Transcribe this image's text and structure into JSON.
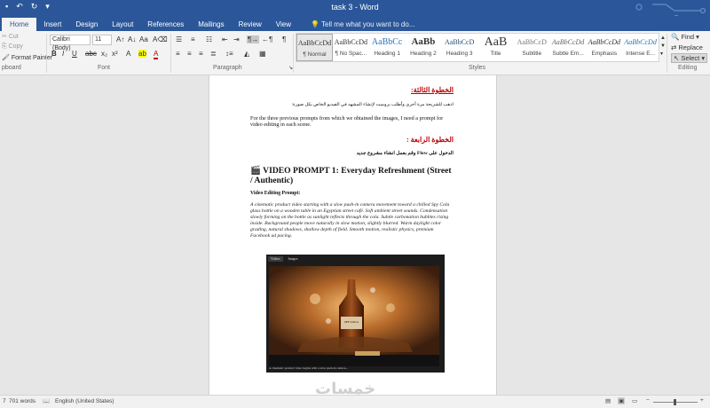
{
  "window": {
    "title": "task 3 - Word"
  },
  "tabs": [
    "Home",
    "Insert",
    "Design",
    "Layout",
    "References",
    "Mailings",
    "Review",
    "View"
  ],
  "tellme": "Tell me what you want to do...",
  "clipboard": {
    "cut": "Cut",
    "copy": "Copy",
    "painter": "Format Painter",
    "label": "pboard"
  },
  "font": {
    "name": "Calibri (Body)",
    "size": "11",
    "label": "Font"
  },
  "paragraph": {
    "label": "Paragraph"
  },
  "styles": {
    "label": "Styles",
    "items": [
      {
        "preview": "AaBbCcDd",
        "name": "¶ Normal"
      },
      {
        "preview": "AaBbCcDd",
        "name": "¶ No Spac..."
      },
      {
        "preview": "AaBbCc",
        "name": "Heading 1"
      },
      {
        "preview": "AaBb",
        "name": "Heading 2"
      },
      {
        "preview": "AaBbCcD",
        "name": "Heading 3"
      },
      {
        "preview": "AaB",
        "name": "Title"
      },
      {
        "preview": "AaBbCcD",
        "name": "Subtitle"
      },
      {
        "preview": "AaBbCcDd",
        "name": "Subtle Em..."
      },
      {
        "preview": "AaBbCcDd",
        "name": "Emphasis"
      },
      {
        "preview": "AaBbCcDd",
        "name": "Intense E..."
      }
    ]
  },
  "editing": {
    "find": "Find",
    "replace": "Replace",
    "select": "Select",
    "label": "Editing"
  },
  "document": {
    "step3_title": "الخطوة الثالثة:",
    "step3_text": "اذهب للشريحة مرة أخرى وأطلب بروميت لإنشاء المشهد في الفيديو الخاص بكل صورة:",
    "english_line": "For the three previous prompts from which we obtained the images, I need a prompt for video editing in each scene.",
    "step4_title": "الخطوة الرابعة :",
    "step4_text": "الدخول على Flow وقم بعمل انشاء مشروع جديد",
    "video_heading": "🎬 VIDEO PROMPT 1: Everyday Refreshment (Street / Authentic)",
    "editing_label": "Video Editing Prompt:",
    "prompt_text": "A cinematic product video starting with a slow push-in camera movement toward a chilled Spy Cola glass bottle on a wooden table in an Egyptian street café. Soft ambient street sounds. Condensation slowly forming on the bottle as sunlight reflects through the cola. Subtle carbonation bubbles rising inside. Background people move naturally in slow motion, slightly blurred. Warm daylight color grading, natural shadows, shallow depth of field. Smooth motion, realistic physics, premium Facebook ad pacing.",
    "video_tabs": [
      "Videos",
      "Images"
    ],
    "bottle_label": "SPY COLA",
    "video_caption": "A cinematic product video begins with a slow push-in camera..."
  },
  "status": {
    "words": "701 words",
    "language": "English (United States)"
  },
  "watermark": "خمسات"
}
